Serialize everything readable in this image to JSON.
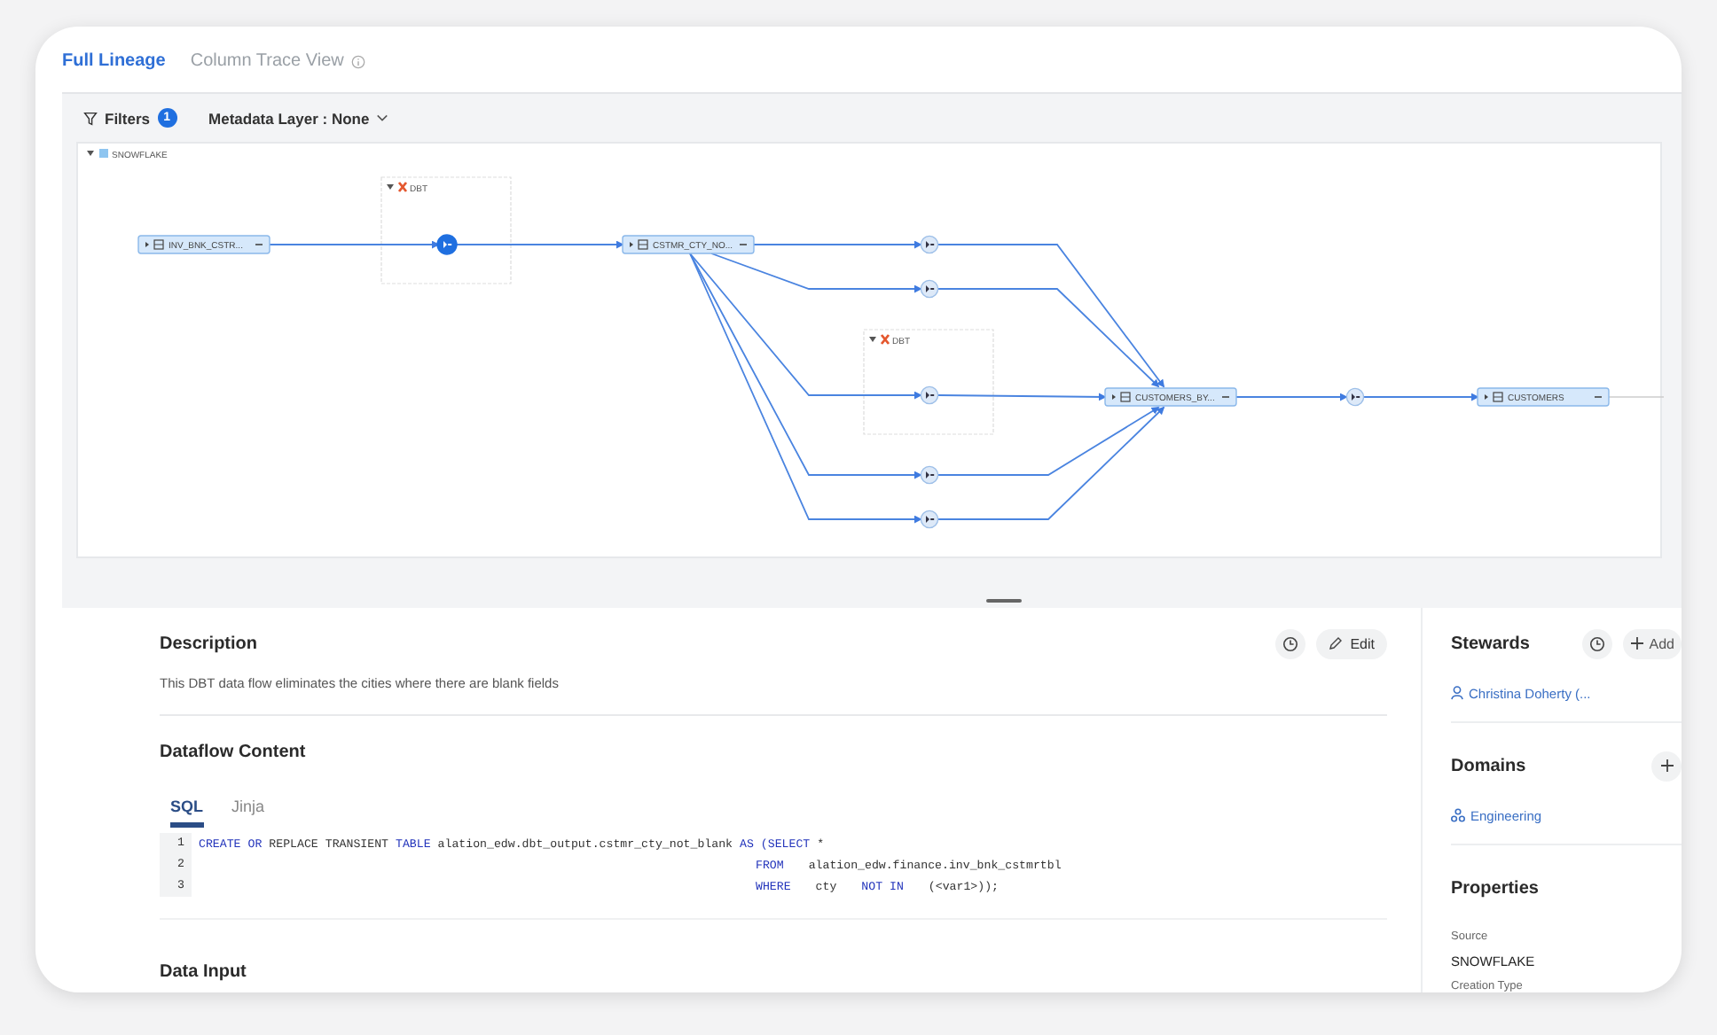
{
  "view_tabs": [
    {
      "label": "Full Lineage",
      "selected": true,
      "info": false
    },
    {
      "label": "Column Trace View",
      "selected": false,
      "info": true
    }
  ],
  "toolbar": {
    "filters": {
      "label": "Filters",
      "badge": "1"
    },
    "metadata_layer": {
      "label": "Metadata Layer : None"
    }
  },
  "graph": {
    "source_label": "SNOWFLAKE",
    "dbt_groups": [
      {
        "label": "DBT"
      },
      {
        "label": "DBT"
      }
    ],
    "tables": [
      {
        "name": "INV_BNK_CSTR..."
      },
      {
        "name": "CSTMR_CTY_NO..."
      },
      {
        "name": "CUSTOMERS_BY..."
      },
      {
        "name": "CUSTOMERS"
      }
    ],
    "processes": [
      {
        "selected": true
      },
      {
        "selected": false
      },
      {
        "selected": false
      },
      {
        "selected": false
      },
      {
        "selected": false
      },
      {
        "selected": false
      },
      {
        "selected": false
      }
    ]
  },
  "description": {
    "title": "Description",
    "edit_label": "Edit",
    "text": "This DBT data flow eliminates the cities where there are blank fields"
  },
  "dataflow": {
    "title": "Dataflow Content",
    "tabs": [
      {
        "label": "SQL",
        "selected": true
      },
      {
        "label": "Jinja",
        "selected": false
      }
    ],
    "code": [
      {
        "number": "1",
        "kind": "first",
        "tokens": [
          {
            "text": "CREATE",
            "kind": "keyword"
          },
          {
            "text": "OR",
            "kind": "keyword"
          },
          {
            "text": "REPLACE",
            "kind": "plain"
          },
          {
            "text": "TRANSIENT",
            "kind": "plain"
          },
          {
            "text": "TABLE",
            "kind": "keyword"
          },
          {
            "text": "alation_edw.dbt_output.cstmr_cty_not_blank",
            "kind": "plain"
          },
          {
            "text": "AS",
            "kind": "keyword"
          },
          {
            "text": "(SELECT",
            "kind": "keyword"
          },
          {
            "text": "*",
            "kind": "plain"
          }
        ]
      },
      {
        "number": "2",
        "kind": "continuation",
        "tokens": [
          {
            "text": "FROM",
            "kind": "keyword"
          },
          {
            "text": "alation_edw.finance.inv_bnk_cstmrtbl",
            "kind": "plain"
          }
        ]
      },
      {
        "number": "3",
        "kind": "continuation",
        "tokens": [
          {
            "text": "WHERE",
            "kind": "keyword"
          },
          {
            "text": "cty",
            "kind": "plain"
          },
          {
            "text": "NOT IN",
            "kind": "keyword"
          },
          {
            "text": "(<var1>));",
            "kind": "plain"
          }
        ]
      }
    ]
  },
  "data_input": {
    "title": "Data Input"
  },
  "sidebar": {
    "stewards": {
      "title": "Stewards",
      "add_label": "Add",
      "person": "Christina Doherty (..."
    },
    "domains": {
      "title": "Domains",
      "domain": "Engineering"
    },
    "properties": {
      "title": "Properties",
      "fields": [
        {
          "label": "Source",
          "value": "SNOWFLAKE"
        },
        {
          "label": "Creation Type"
        }
      ]
    }
  }
}
